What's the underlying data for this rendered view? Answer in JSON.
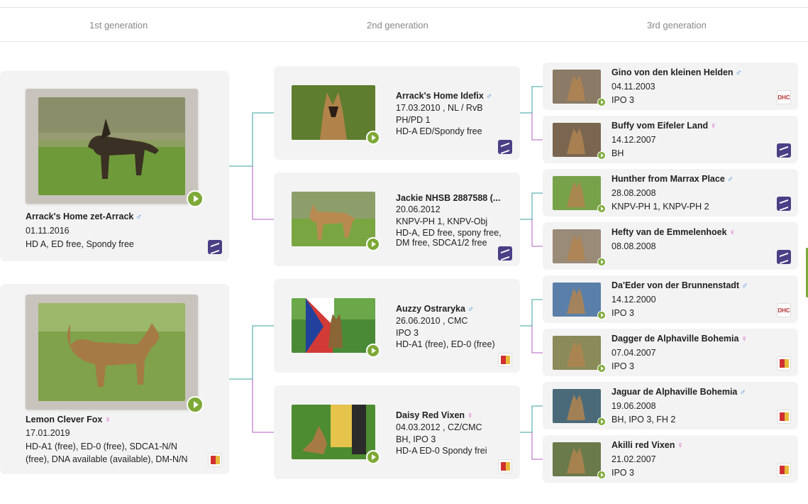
{
  "generations": [
    "1st generation",
    "2nd generation",
    "3rd generation"
  ],
  "gen1": [
    {
      "name": "Arrack's Home zet-Arrack",
      "sex": "♂",
      "date": "01.11.2016",
      "info": [
        "HD A, ED free, Spondy free"
      ],
      "club": "purple-icon"
    },
    {
      "name": "Lemon Clever Fox",
      "sex": "♀",
      "date": "17.01.2019",
      "info": [
        "HD-A1 (free), ED-0 (free), SDCA1-N/N",
        "(free), DNA available (available), DM-N/N"
      ],
      "club": "cmku-icon"
    }
  ],
  "gen2": [
    {
      "name": "Arrack's Home Idefix",
      "sex": "♂",
      "date": "17.03.2010 , NL / RvB",
      "info": [
        "PH/PD 1",
        "HD-A ED/Spondy free"
      ],
      "club": "purple-icon"
    },
    {
      "name": "Jackie NHSB 2887588 (...",
      "sex": "",
      "date": "20.06.2012",
      "info": [
        "KNPV-PH 1, KNPV-Obj",
        "HD-A, ED free, spony free,",
        "DM free, SDCA1/2 free"
      ],
      "club": "purple-icon"
    },
    {
      "name": "Auzzy Ostraryka",
      "sex": "♂",
      "date": "26.06.2010 , CMC",
      "info": [
        "IPO 3",
        "HD-A1 (free), ED-0 (free)"
      ],
      "club": "cmku-icon"
    },
    {
      "name": "Daisy Red Vixen",
      "sex": "♀",
      "date": "04.03.2012 , CZ/CMC",
      "info": [
        "BH, IPO 3",
        "HD-A ED-0 Spondy frei"
      ],
      "club": "cmku-icon"
    }
  ],
  "gen3": [
    {
      "name": "Gino von den kleinen Helden",
      "sex": "♂",
      "date": "04.11.2003",
      "info": [
        "IPO 3"
      ],
      "club": "dhc-icon"
    },
    {
      "name": "Buffy vom Eifeler Land",
      "sex": "♀",
      "date": "14.12.2007",
      "info": [
        "BH"
      ],
      "club": "purple-icon"
    },
    {
      "name": "Hunther from Marrax Place",
      "sex": "♂",
      "date": "28.08.2008",
      "info": [
        "KNPV-PH 1, KNPV-PH 2"
      ],
      "club": "purple-icon"
    },
    {
      "name": "Hefty van de Emmelenhoek",
      "sex": "♀",
      "date": "08.08.2008",
      "info": [],
      "club": "purple-icon"
    },
    {
      "name": "Da'Eder von der Brunnenstadt",
      "sex": "♂",
      "date": "14.12.2000",
      "info": [
        "IPO 3"
      ],
      "club": "dhc-icon"
    },
    {
      "name": "Dagger de Alphaville Bohemia",
      "sex": "♀",
      "date": "07.04.2007",
      "info": [
        "IPO 3"
      ],
      "club": "cmku-icon"
    },
    {
      "name": "Jaguar de Alphaville Bohemia",
      "sex": "♂",
      "date": "19.06.2008",
      "info": [
        "BH, IPO 3, FH 2"
      ],
      "club": "cmku-icon"
    },
    {
      "name": "Akilli red Vixen",
      "sex": "♀",
      "date": "21.02.2007",
      "info": [
        "IPO 3"
      ],
      "club": "cmku-icon"
    }
  ],
  "club_dhc_text": "DHC",
  "colors": {
    "male": "#4a8fd8",
    "female": "#d64fc3",
    "play": "#7da936",
    "line_male": "#3aa0a0",
    "line_female": "#b05cc0"
  }
}
